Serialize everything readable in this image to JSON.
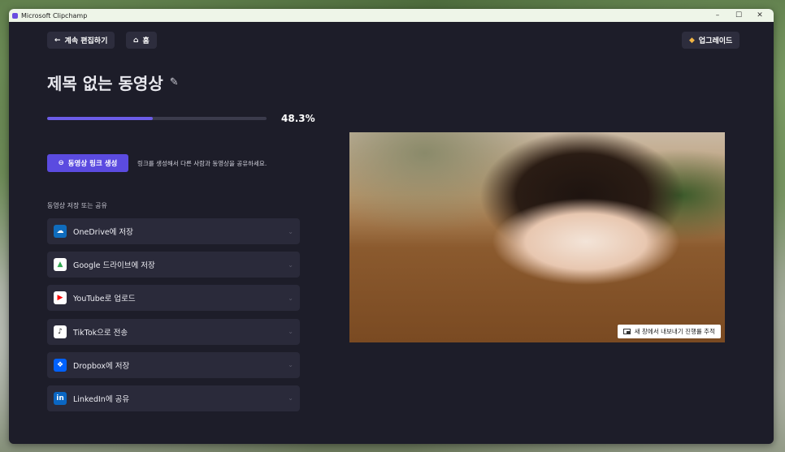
{
  "window": {
    "title": "Microsoft Clipchamp",
    "minimize": "–",
    "maximize": "☐",
    "close": "✕"
  },
  "nav": {
    "back_icon": "←",
    "back_label": "계속 편집하기",
    "home_icon": "⌂",
    "home_label": "홈",
    "upgrade_icon": "◆",
    "upgrade_label": "업그레이드"
  },
  "page": {
    "title": "제목 없는 동영상",
    "edit_icon": "✎"
  },
  "export": {
    "progress_fraction": 0.483,
    "progress_text": "48.3%"
  },
  "link": {
    "icon": "⊖",
    "button_label": "동영상 링크 생성",
    "description": "링크를 생성해서 다른 사람과 동영상을 공유하세요."
  },
  "share": {
    "section_label": "동영상 저장 또는 공유",
    "items": [
      {
        "label": "OneDrive에 저장",
        "icon": "☁",
        "color": "#0f6cbd"
      },
      {
        "label": "Google 드라이브에 저장",
        "icon": "▲",
        "color": "#ffffff"
      },
      {
        "label": "YouTube로 업로드",
        "icon": "▶",
        "color": "#ffffff"
      },
      {
        "label": "TikTok으로 전송",
        "icon": "♪",
        "color": "#ffffff"
      },
      {
        "label": "Dropbox에 저장",
        "icon": "❖",
        "color": "#0061fe"
      },
      {
        "label": "LinkedIn에 공유",
        "icon": "in",
        "color": "#0a66c2"
      }
    ]
  },
  "preview": {
    "track_label": "새 창에서 내보내기 진행률 추적"
  }
}
